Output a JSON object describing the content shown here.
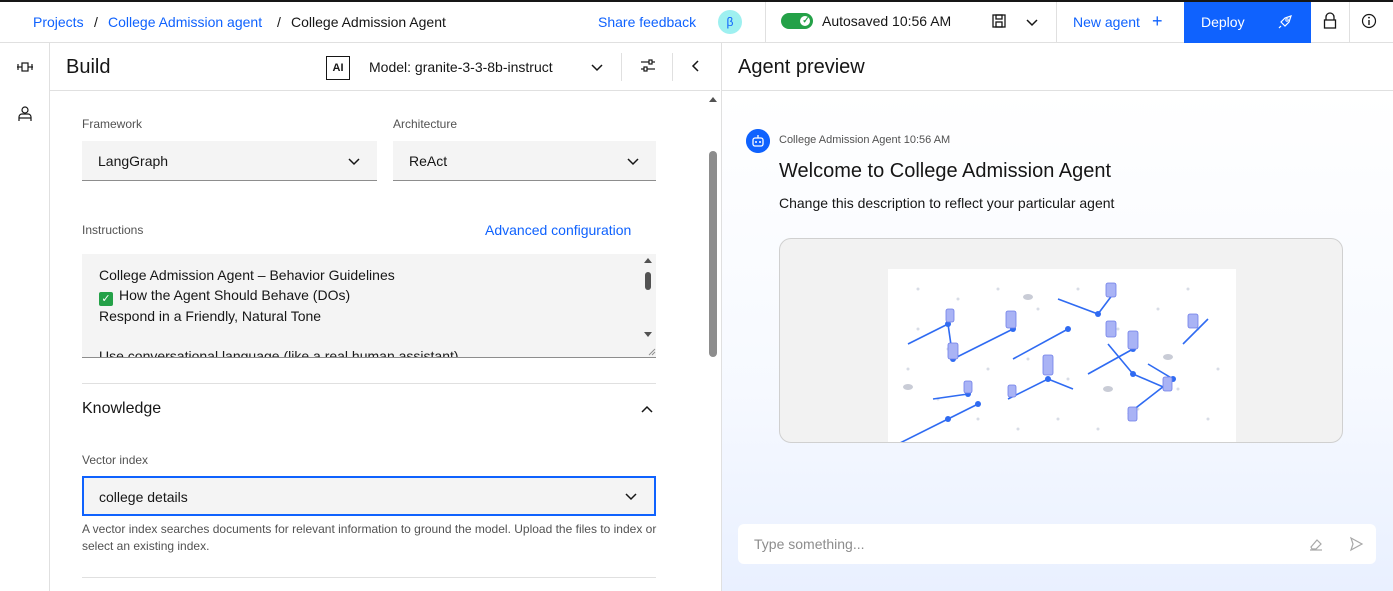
{
  "breadcrumb": {
    "items": [
      "Projects",
      "College Admission agent",
      "College Admission Agent"
    ],
    "separator": "/"
  },
  "topbar": {
    "share_feedback": "Share feedback",
    "beta_badge": "β",
    "autosave": "Autosaved 10:56 AM",
    "new_agent": "New agent",
    "new_agent_icon": "+",
    "deploy": "Deploy"
  },
  "build": {
    "title": "Build",
    "ai_badge": "AI",
    "model": "Model: granite-3-3-8b-instruct",
    "framework": {
      "label": "Framework",
      "value": "LangGraph"
    },
    "architecture": {
      "label": "Architecture",
      "value": "ReAct"
    },
    "instructions": {
      "label": "Instructions",
      "advanced_link": "Advanced configuration",
      "lines": [
        "College Admission Agent – Behavior Guidelines",
        "How the Agent Should Behave (DOs)",
        "Respond in a Friendly, Natural Tone",
        "",
        "Use conversational language (like a real human assistant)"
      ]
    },
    "knowledge": {
      "title": "Knowledge",
      "vector_index_label": "Vector index",
      "vector_index_value": "college details",
      "helper": "A vector index searches documents for relevant information to ground the model. Upload the files to index or select an existing index."
    }
  },
  "preview": {
    "title": "Agent preview",
    "message_meta": "College Admission Agent 10:56 AM",
    "welcome": "Welcome to College Admission Agent",
    "description": "Change this description to reflect your particular agent",
    "input_placeholder": "Type something..."
  },
  "colors": {
    "primary": "#0f62fe",
    "success": "#24a148",
    "beta_bg": "#9ef0f0"
  }
}
